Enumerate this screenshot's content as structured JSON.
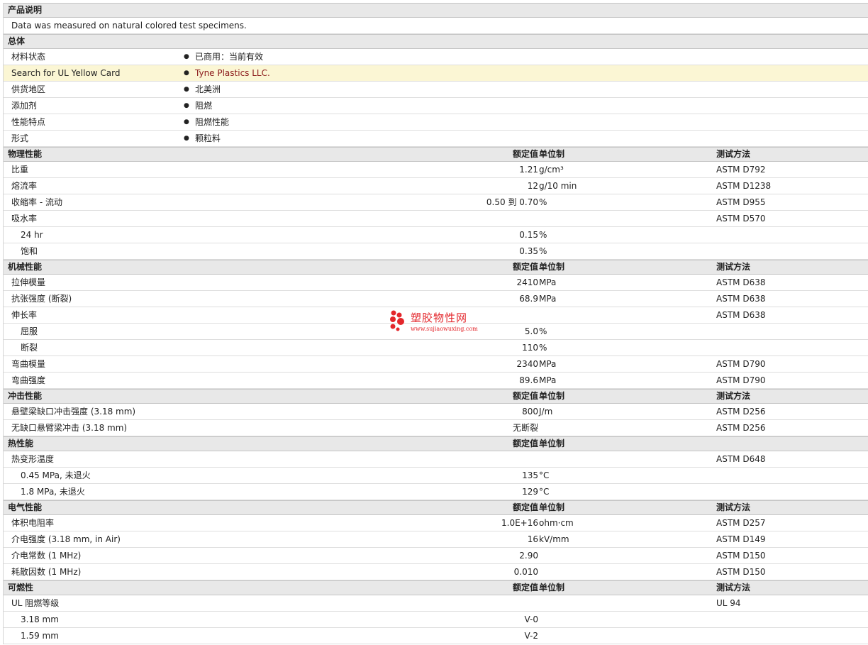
{
  "description": {
    "header": "产品说明",
    "text": "Data was measured on natural colored test specimens."
  },
  "general": {
    "header": "总体",
    "rows": [
      {
        "label": "材料状态",
        "value": "已商用：当前有效"
      },
      {
        "label": "Search for UL Yellow Card",
        "value": "Tyne Plastics LLC."
      },
      {
        "label": "供货地区",
        "value": "北美洲"
      },
      {
        "label": "添加剂",
        "value": "阻燃"
      },
      {
        "label": "性能特点",
        "value": "阻燃性能"
      },
      {
        "label": "形式",
        "value": "颗粒料"
      }
    ]
  },
  "column_labels": {
    "value": "额定值",
    "unit": "单位制",
    "method": "测试方法"
  },
  "sections": [
    {
      "title": "物理性能",
      "rows": [
        {
          "name": "比重",
          "value": "1.21",
          "unit": "g/cm³",
          "method": "ASTM D792"
        },
        {
          "name": "熔流率",
          "value": "12",
          "unit": "g/10 min",
          "method": "ASTM D1238"
        },
        {
          "name": "收缩率  - 流动",
          "value": "0.50 到  0.70",
          "unit": "%",
          "method": "ASTM D955"
        },
        {
          "name": "吸水率",
          "value": "",
          "unit": "",
          "method": "ASTM D570"
        },
        {
          "name": "24 hr",
          "value": "0.15",
          "unit": "%",
          "method": ""
        },
        {
          "name": "饱和",
          "value": "0.35",
          "unit": "%",
          "method": ""
        }
      ]
    },
    {
      "title": "机械性能",
      "rows": [
        {
          "name": "拉伸模量",
          "value": "2410",
          "unit": "MPa",
          "method": "ASTM D638"
        },
        {
          "name": "抗张强度  (断裂)",
          "value": "68.9",
          "unit": "MPa",
          "method": "ASTM D638"
        },
        {
          "name": "伸长率",
          "value": "",
          "unit": "",
          "method": "ASTM D638"
        },
        {
          "name": "屈服",
          "value": "5.0",
          "unit": "%",
          "method": ""
        },
        {
          "name": "断裂",
          "value": "110",
          "unit": "%",
          "method": ""
        },
        {
          "name": "弯曲模量",
          "value": "2340",
          "unit": "MPa",
          "method": "ASTM D790"
        },
        {
          "name": "弯曲强度",
          "value": "89.6",
          "unit": "MPa",
          "method": "ASTM D790"
        }
      ]
    },
    {
      "title": "冲击性能",
      "rows": [
        {
          "name": "悬壁梁缺口冲击强度  (3.18 mm)",
          "value": "800",
          "unit": "J/m",
          "method": "ASTM D256"
        },
        {
          "name": "无缺口悬臂梁冲击  (3.18 mm)",
          "value": "无断裂",
          "unit": "",
          "method": "ASTM D256"
        }
      ]
    },
    {
      "title": "热性能",
      "rows": [
        {
          "name": "热变形温度",
          "value": "",
          "unit": "",
          "method": "ASTM D648"
        },
        {
          "name": "0.45 MPa, 未退火",
          "value": "135",
          "unit": "°C",
          "method": ""
        },
        {
          "name": "1.8 MPa, 未退火",
          "value": "129",
          "unit": "°C",
          "method": ""
        }
      ]
    },
    {
      "title": "电气性能",
      "rows": [
        {
          "name": "体积电阻率",
          "value": "1.0E+16",
          "unit": "ohm·cm",
          "method": "ASTM D257"
        },
        {
          "name": "介电强度  (3.18 mm, in Air)",
          "value": "16",
          "unit": "kV/mm",
          "method": "ASTM D149"
        },
        {
          "name": "介电常数  (1 MHz)",
          "value": "2.90",
          "unit": "",
          "method": "ASTM D150"
        },
        {
          "name": "耗散因数  (1 MHz)",
          "value": "0.010",
          "unit": "",
          "method": "ASTM D150"
        }
      ]
    },
    {
      "title": "可燃性",
      "rows": [
        {
          "name": "UL 阻燃等级",
          "value": "",
          "unit": "",
          "method": "UL 94"
        },
        {
          "name": "3.18 mm",
          "value": "V-0",
          "unit": "",
          "method": ""
        },
        {
          "name": "1.59 mm",
          "value": "V-2",
          "unit": "",
          "method": ""
        }
      ]
    }
  ],
  "watermark": {
    "title": "塑胶物性网",
    "url": "www.sujiaowuxing.com",
    "color": "#e3262b"
  },
  "colors": {
    "header_bg": "#e8e8e8",
    "highlight_bg": "#fbf6d4",
    "link": "#8b1a1a"
  }
}
